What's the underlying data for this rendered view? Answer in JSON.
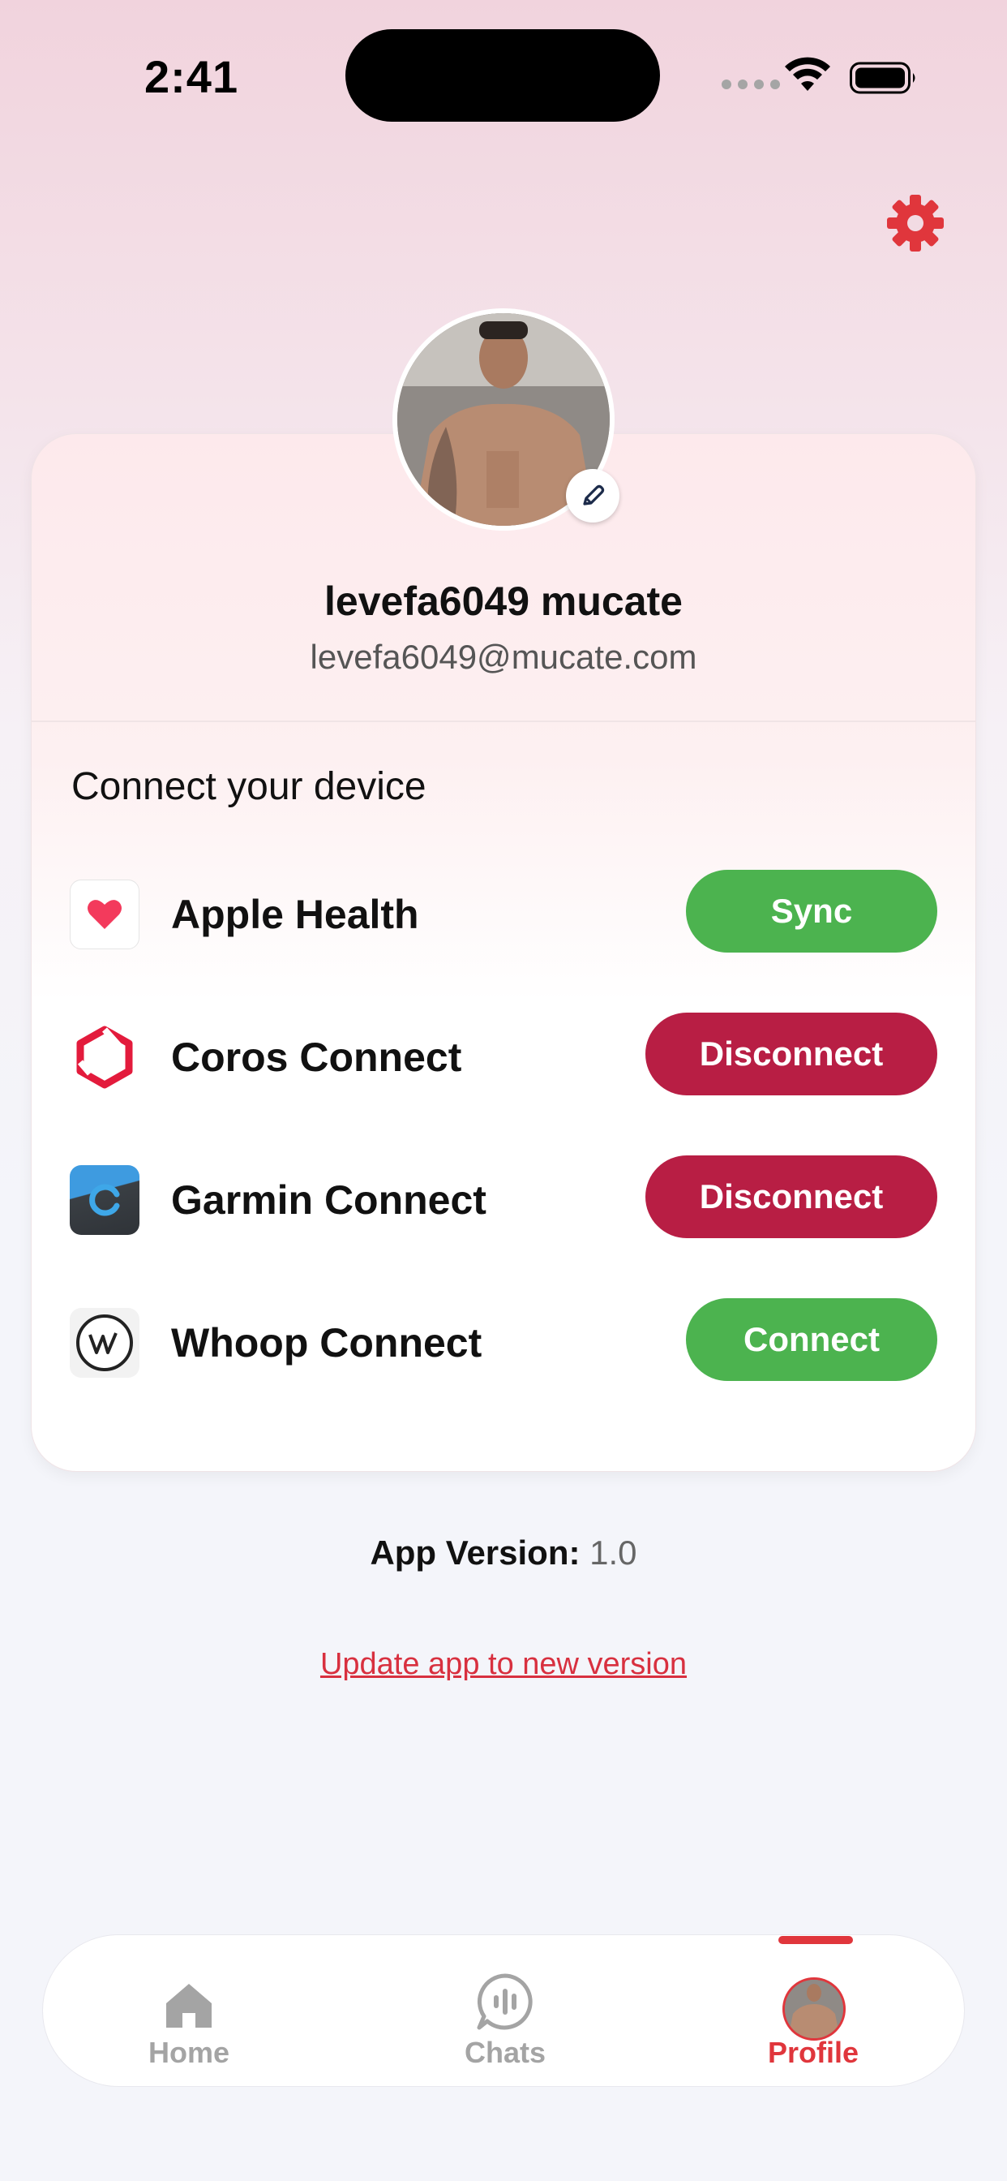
{
  "status_bar": {
    "time": "2:41"
  },
  "profile": {
    "name": "levefa6049 mucate",
    "email": "levefa6049@mucate.com"
  },
  "devices": {
    "title": "Connect your device",
    "items": [
      {
        "name": "Apple Health",
        "action": "Sync",
        "icon": "apple-health-icon"
      },
      {
        "name": "Coros Connect",
        "action": "Disconnect",
        "icon": "coros-icon"
      },
      {
        "name": "Garmin Connect",
        "action": "Disconnect",
        "icon": "garmin-icon"
      },
      {
        "name": "Whoop Connect",
        "action": "Connect",
        "icon": "whoop-icon"
      }
    ]
  },
  "app_version": {
    "label": "App Version:",
    "value": "1.0"
  },
  "update_link": "Update app to new version",
  "nav": {
    "tabs": [
      {
        "label": "Home",
        "icon": "home-icon"
      },
      {
        "label": "Chats",
        "icon": "chat-icon"
      },
      {
        "label": "Profile",
        "icon": "avatar"
      }
    ],
    "active": "Profile"
  },
  "colors": {
    "accent": "#e0363c",
    "green": "#4cb34f",
    "disconnect_red": "#b81e44"
  }
}
